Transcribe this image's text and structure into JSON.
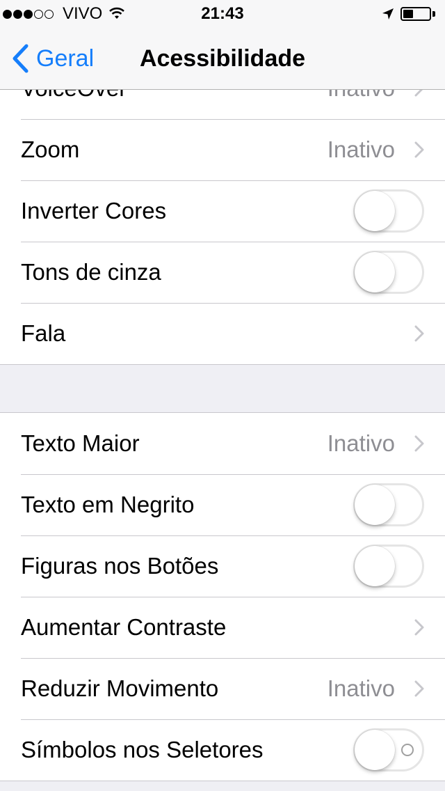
{
  "status_bar": {
    "carrier": "VIVO",
    "time": "21:43",
    "signal_bars_filled": 3,
    "signal_bars_total": 5
  },
  "nav": {
    "back_label": "Geral",
    "title": "Acessibilidade"
  },
  "group1": [
    {
      "label": "VoiceOver",
      "value": "Inativo",
      "control": "chevron"
    },
    {
      "label": "Zoom",
      "value": "Inativo",
      "control": "chevron"
    },
    {
      "label": "Inverter Cores",
      "control": "toggle",
      "on": false
    },
    {
      "label": "Tons de cinza",
      "control": "toggle",
      "on": false
    },
    {
      "label": "Fala",
      "control": "chevron"
    }
  ],
  "group2": [
    {
      "label": "Texto Maior",
      "value": "Inativo",
      "control": "chevron"
    },
    {
      "label": "Texto em Negrito",
      "control": "toggle",
      "on": false
    },
    {
      "label": "Figuras nos Botões",
      "control": "toggle",
      "on": false
    },
    {
      "label": "Aumentar Contraste",
      "control": "chevron"
    },
    {
      "label": "Reduzir Movimento",
      "value": "Inativo",
      "control": "chevron"
    },
    {
      "label": "Símbolos nos Seletores",
      "control": "toggle",
      "on": false,
      "shows_symbol": true
    }
  ],
  "colors": {
    "accent": "#157efb",
    "secondary_text": "#8e8e93",
    "background": "#efeff4",
    "separator": "#c8c7cc"
  }
}
